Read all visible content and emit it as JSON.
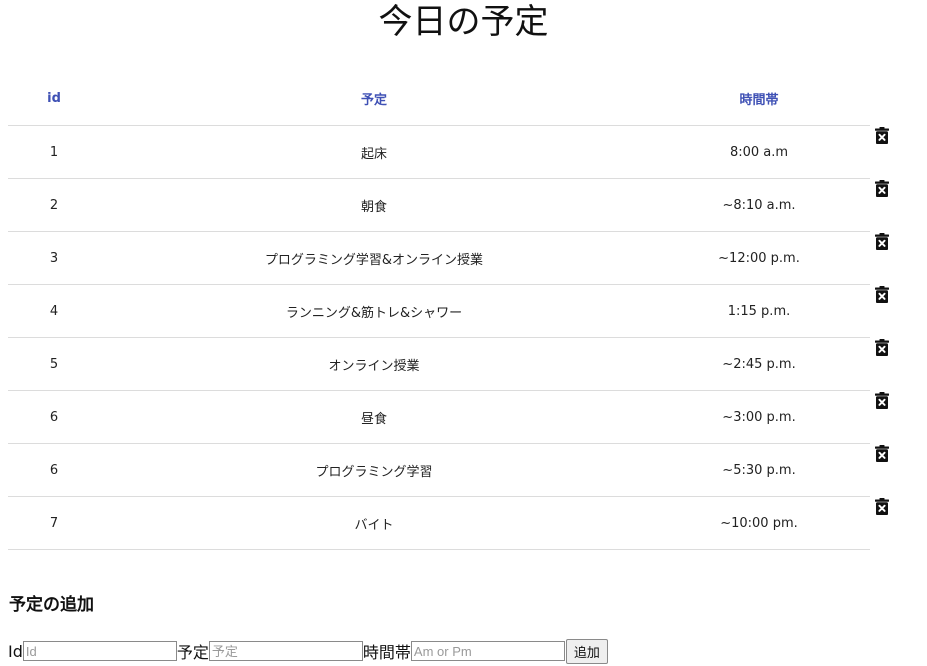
{
  "page": {
    "title": "今日の予定"
  },
  "table": {
    "headers": {
      "id": "id",
      "plan": "予定",
      "time": "時間帯"
    },
    "rows": [
      {
        "id": "1",
        "plan": "起床",
        "time": "8:00 a.m"
      },
      {
        "id": "2",
        "plan": "朝食",
        "time": "~8:10 a.m."
      },
      {
        "id": "3",
        "plan": "プログラミング学習&オンライン授業",
        "time": "~12:00 p.m."
      },
      {
        "id": "4",
        "plan": "ランニング&筋トレ&シャワー",
        "time": "1:15 p.m."
      },
      {
        "id": "5",
        "plan": "オンライン授業",
        "time": "~2:45 p.m."
      },
      {
        "id": "6",
        "plan": "昼食",
        "time": "~3:00 p.m."
      },
      {
        "id": "6",
        "plan": "プログラミング学習",
        "time": "~5:30 p.m."
      },
      {
        "id": "7",
        "plan": "バイト",
        "time": "~10:00 pm."
      }
    ],
    "row_action_icon": "trash-icon"
  },
  "add_section": {
    "title": "予定の追加",
    "id_label": "Id",
    "id_placeholder": "Id",
    "plan_label": "予定",
    "plan_placeholder": "予定",
    "time_label": "時間帯",
    "time_placeholder": "Am or Pm",
    "submit_label": "追加"
  },
  "colors": {
    "header_text": "#3f51b5",
    "divider": "#dcdcdc"
  }
}
